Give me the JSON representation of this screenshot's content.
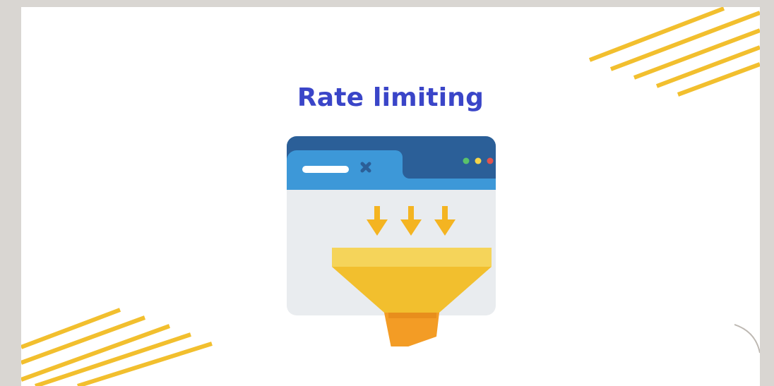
{
  "title": "Rate limiting",
  "colors": {
    "title": "#3a45c8",
    "stripe": "#f2bf2e",
    "browser_dark": "#2b5f98",
    "browser_tab": "#3d98d8",
    "browser_body": "#e9ecef",
    "funnel_top": "#f5d45a",
    "funnel_body": "#f2bf2e",
    "funnel_spout": "#f39c25",
    "arrow": "#f4b421",
    "dot_green": "#5ac26a",
    "dot_yellow": "#f5d54a",
    "dot_red": "#e2544e"
  },
  "icons": [
    "browser-window-icon",
    "close-x-icon",
    "down-arrow-icon",
    "funnel-icon"
  ]
}
